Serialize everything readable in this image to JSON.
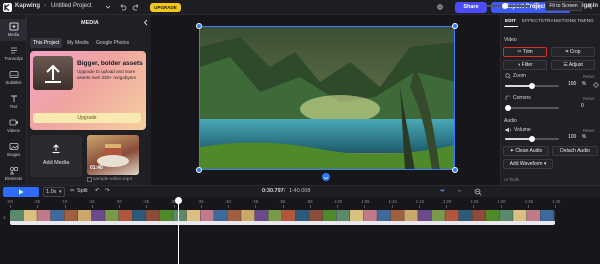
{
  "topbar": {
    "brand": "Kapwing",
    "separator": "›",
    "project_name": "Untitled Project",
    "upgrade": "UPGRADE",
    "share": "Share",
    "export": "Export Project",
    "sign_in": "Sign In"
  },
  "rail": {
    "items": [
      {
        "label": "Media",
        "icon": "media-icon"
      },
      {
        "label": "Transcript",
        "icon": "transcript-icon"
      },
      {
        "label": "Subtitles",
        "icon": "subtitles-icon"
      },
      {
        "label": "Text",
        "icon": "text-icon"
      },
      {
        "label": "Videos",
        "icon": "videos-icon"
      },
      {
        "label": "Images",
        "icon": "images-icon"
      },
      {
        "label": "Elements",
        "icon": "elements-icon"
      }
    ]
  },
  "media": {
    "title": "MEDIA",
    "tabs": [
      "This Project",
      "My Media",
      "Google Photos"
    ],
    "promo": {
      "title": "Bigger, bolder assets",
      "body": "Upgrade to upload and store assets over 250+ megabytes",
      "button": "Upgrade"
    },
    "add_media": "Add Media",
    "clip": {
      "duration": "01:40",
      "name": "sample-video.mp4"
    }
  },
  "right": {
    "tabs": [
      "EDIT",
      "EFFECTS",
      "TRANSITIONS",
      "TIMING"
    ],
    "video_section": "Video",
    "trim": "Trim",
    "crop": "Crop",
    "filter": "Filter",
    "adjust": "Adjust",
    "zoom_label": "Zoom",
    "zoom_value": "100",
    "zoom_unit": "%",
    "reset": "Reset",
    "corners_label": "Corners",
    "corners_value": "0",
    "audio_section": "Audio",
    "volume_label": "Volume",
    "volume_value": "100",
    "volume_unit": "%",
    "clean_audio": "Clean Audio",
    "detach_audio": "Detach Audio",
    "add_waveform": "Add Waveform",
    "ai_tools": "AI Tools",
    "zoom_level": 0.5,
    "volume_level": 0.5
  },
  "transport": {
    "speed": "1.0x",
    "split": "Split",
    "current_time": "0:30.797",
    "total_time": "1:40.008",
    "fit": "Fit to Screen"
  },
  "timeline": {
    "ticks": [
      ":00",
      ":05",
      ":10",
      ":15",
      ":20",
      ":25",
      ":30",
      ":35",
      ":40",
      ":45",
      ":50",
      ":55",
      "1:00",
      "1:05",
      "1:10",
      "1:15",
      "1:20",
      "1:25",
      "1:30",
      "1:35",
      "1:40"
    ],
    "track_index": "1"
  },
  "colors": {
    "accent": "#3d5afe",
    "upgrade": "#f3c61c",
    "highlight": "#e12a2a",
    "selection": "#2d7bff"
  }
}
